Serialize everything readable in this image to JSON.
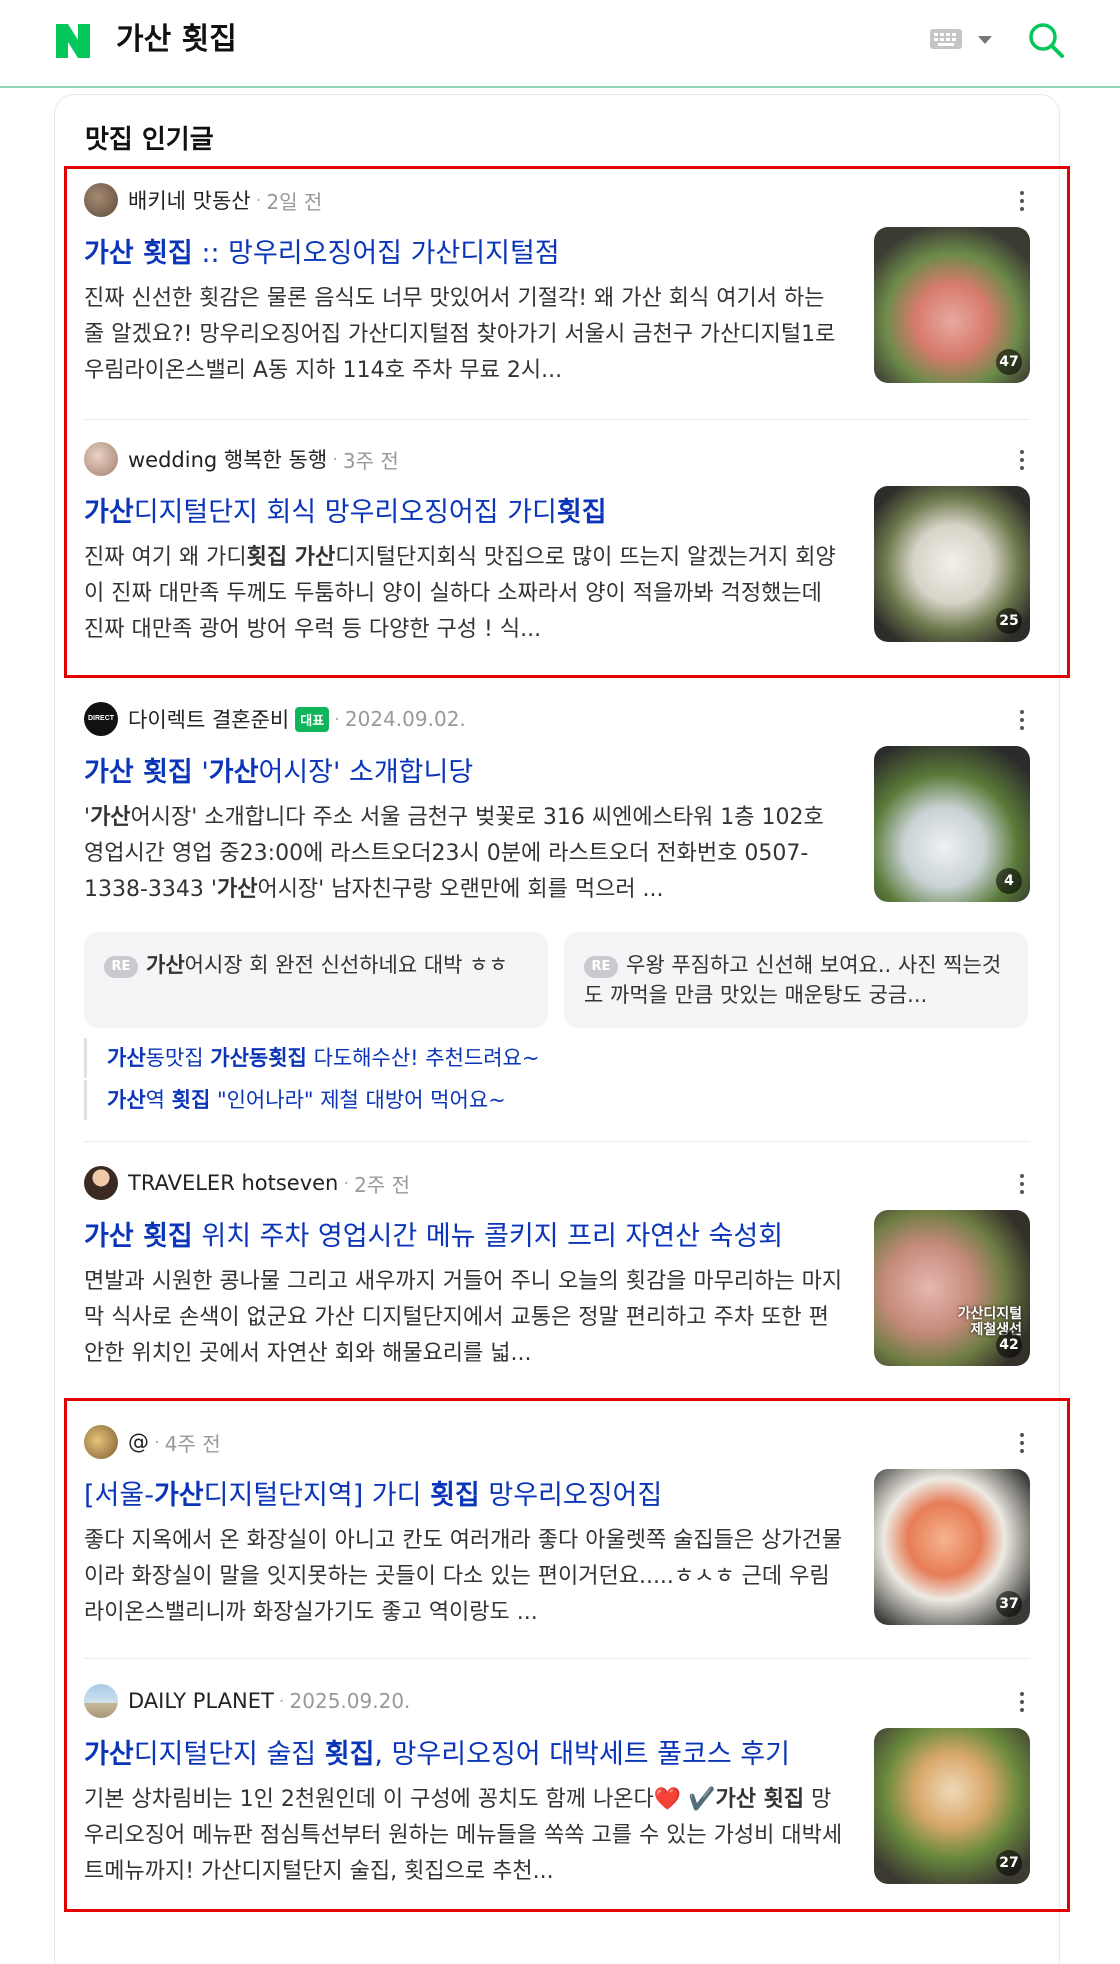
{
  "header": {
    "query": "가산 횟집",
    "keyboard_icon": "keyboard-icon",
    "search_icon": "search-icon",
    "brand_color": "#03c75a"
  },
  "section_title": "맛집 인기글",
  "posts": [
    {
      "author": "배키네 맛동산",
      "date": "2일 전",
      "title_parts": [
        {
          "text": "가산 횟집",
          "bold": true
        },
        {
          "text": " :: 망우리오징어집 가산디지털점",
          "bold": false
        }
      ],
      "desc": "진짜 신선한 횟감은 물론 음식도 너무 맛있어서 기절각! 왜 가산 회식 여기서 하는줄 알겠요?! 망우리오징어집 가산디지털점 찾아가기 서울시 금천구 가산디지털1로 우림라이온스밸리 A동 지하 114호 주차 무료 2시...",
      "image_count": "47"
    },
    {
      "author": "wedding 행복한 동행",
      "date": "3주 전",
      "title_parts": [
        {
          "text": "가산",
          "bold": true
        },
        {
          "text": "디지털단지 회식 망우리오징어집 가디",
          "bold": false
        },
        {
          "text": "횟집",
          "bold": true
        }
      ],
      "desc_parts": [
        {
          "text": "진짜 여기 왜 가디",
          "bold": false
        },
        {
          "text": "횟집 가산",
          "bold": true
        },
        {
          "text": "디지털단지회식 맛집으로 많이 뜨는지 알겠는거지 회양이 진짜 대만족 두께도 두툼하니 양이 실하다 소짜라서 양이 적을까봐 걱정했는데 진짜 대만족 광어 방어 우럭 등 다양한 구성 ! 식...",
          "bold": false
        }
      ],
      "image_count": "25"
    },
    {
      "author": "다이렉트 결혼준비",
      "badge": "대표",
      "date": "2024.09.02.",
      "title_parts": [
        {
          "text": "가산 횟집",
          "bold": true
        },
        {
          "text": " '",
          "bold": false
        },
        {
          "text": "가산",
          "bold": true
        },
        {
          "text": "어시장' 소개합니당",
          "bold": false
        }
      ],
      "desc_parts": [
        {
          "text": "'",
          "bold": false
        },
        {
          "text": "가산",
          "bold": true
        },
        {
          "text": "어시장' 소개합니다 주소 서울 금천구 벚꽃로 316 씨엔에스타워 1층 102호 영업시간 영업 중23:00에 라스트오더23시 0분에 라스트오더 전화번호 0507-1338-3343 '",
          "bold": false
        },
        {
          "text": "가산",
          "bold": true
        },
        {
          "text": "어시장' 남자친구랑 오랜만에 회를 먹으러 ...",
          "bold": false
        }
      ],
      "image_count": "4",
      "replies": [
        {
          "label": "RE",
          "parts": [
            {
              "text": "가산",
              "bold": true
            },
            {
              "text": "어시장 회 완전 신선하네요 대박 ㅎㅎ",
              "bold": false
            }
          ]
        },
        {
          "label": "RE",
          "parts": [
            {
              "text": "우왕 푸짐하고 신선해 보여요.. 사진 찍는것도 까먹을 만큼 맛있는 매운탕도 궁금...",
              "bold": false
            }
          ]
        }
      ],
      "related": [
        {
          "parts": [
            {
              "text": "가산",
              "bold": true
            },
            {
              "text": "동맛집 ",
              "bold": false
            },
            {
              "text": "가산동횟집",
              "bold": true
            },
            {
              "text": " 다도해수산! 추천드려요~",
              "bold": false
            }
          ]
        },
        {
          "parts": [
            {
              "text": "가산",
              "bold": true
            },
            {
              "text": "역 ",
              "bold": false
            },
            {
              "text": "횟집",
              "bold": true
            },
            {
              "text": " \"인어나라\" 제철 대방어 먹어요~",
              "bold": false
            }
          ]
        }
      ]
    },
    {
      "author": "TRAVELER hotseven",
      "date": "2주 전",
      "title_parts": [
        {
          "text": "가산 횟집",
          "bold": true
        },
        {
          "text": " 위치 주차 영업시간 메뉴 콜키지 프리 자연산 숙성회",
          "bold": false
        }
      ],
      "desc": "면발과 시원한 콩나물 그리고 새우까지 거들어 주니 오늘의 횟감을 마무리하는 마지막 식사로 손색이 없군요 가산 디지털단지에서 교통은 정말 편리하고 주차 또한 편안한 위치인 곳에서 자연산 회와 해물요리를 넓...",
      "image_count": "42",
      "image_overlay_text": "가산디지털 제철생선"
    },
    {
      "author": "@",
      "date": "4주 전",
      "title_parts": [
        {
          "text": "[서울-",
          "bold": false
        },
        {
          "text": "가산",
          "bold": true
        },
        {
          "text": "디지털단지역] 가디 ",
          "bold": false
        },
        {
          "text": "횟집",
          "bold": true
        },
        {
          "text": " 망우리오징어집",
          "bold": false
        }
      ],
      "desc": "좋다 지옥에서 온 화장실이 아니고 칸도 여러개라 좋다 아울렛쪽 술집들은 상가건물이라 화장실이 말을 잇지못하는 곳들이 다소 있는 편이거던요.....ㅎㅅㅎ 근데 우림라이온스밸리니까 화장실가기도 좋고 역이랑도 ...",
      "image_count": "37"
    },
    {
      "author": "DAILY PLANET",
      "date": "2025.09.20.",
      "title_parts": [
        {
          "text": "가산",
          "bold": true
        },
        {
          "text": "디지털단지 술집 ",
          "bold": false
        },
        {
          "text": "횟집",
          "bold": true
        },
        {
          "text": ", 망우리오징어 대박세트 풀코스 후기",
          "bold": false
        }
      ],
      "desc_parts": [
        {
          "text": "기본 상차림비는 1인 2천원인데 이 구성에 꽁치도 함께 나온다",
          "bold": false
        },
        {
          "text": "❤️ ✔️",
          "bold": false
        },
        {
          "text": "가산 횟집",
          "bold": true
        },
        {
          "text": " 망우리오징어 메뉴판 점심특선부터 원하는 메뉴들을 쏙쏙 고를 수 있는 가성비 대박세트메뉴까지! 가산디지털단지 술집, 횟집으로 추천...",
          "bold": false
        }
      ],
      "image_count": "27"
    }
  ]
}
